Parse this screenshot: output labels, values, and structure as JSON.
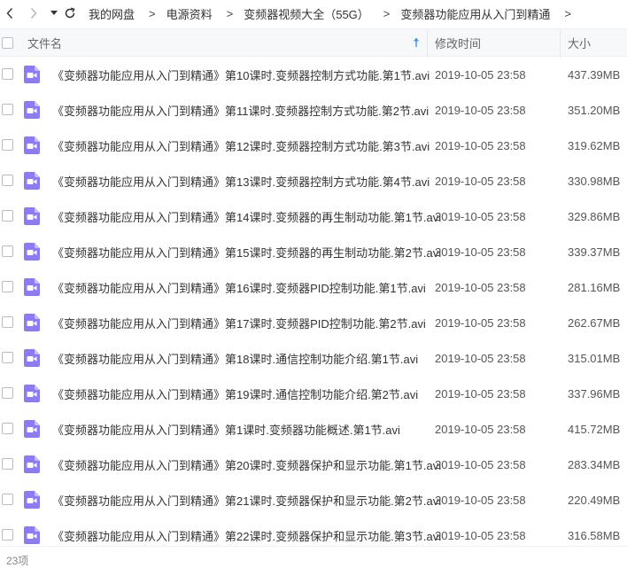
{
  "nav": {
    "breadcrumb": [
      "我的网盘",
      "电源资料",
      "变频器视频大全（55G）",
      "变频器功能应用从入门到精通"
    ],
    "separator": ">"
  },
  "header": {
    "name_label": "文件名",
    "time_label": "修改时间",
    "size_label": "大小"
  },
  "files": [
    {
      "name": "《变频器功能应用从入门到精通》第10课时.变频器控制方式功能.第1节.avi",
      "time": "2019-10-05 23:58",
      "size": "437.39MB"
    },
    {
      "name": "《变频器功能应用从入门到精通》第11课时.变频器控制方式功能.第2节.avi",
      "time": "2019-10-05 23:58",
      "size": "351.20MB"
    },
    {
      "name": "《变频器功能应用从入门到精通》第12课时.变频器控制方式功能.第3节.avi",
      "time": "2019-10-05 23:58",
      "size": "319.62MB"
    },
    {
      "name": "《变频器功能应用从入门到精通》第13课时.变频器控制方式功能.第4节.avi",
      "time": "2019-10-05 23:58",
      "size": "330.98MB"
    },
    {
      "name": "《变频器功能应用从入门到精通》第14课时.变频器的再生制动功能.第1节.avi",
      "time": "2019-10-05 23:58",
      "size": "329.86MB"
    },
    {
      "name": "《变频器功能应用从入门到精通》第15课时.变频器的再生制动功能.第2节.avi",
      "time": "2019-10-05 23:58",
      "size": "339.37MB"
    },
    {
      "name": "《变频器功能应用从入门到精通》第16课时.变频器PID控制功能.第1节.avi",
      "time": "2019-10-05 23:58",
      "size": "281.16MB"
    },
    {
      "name": "《变频器功能应用从入门到精通》第17课时.变频器PID控制功能.第2节.avi",
      "time": "2019-10-05 23:58",
      "size": "262.67MB"
    },
    {
      "name": "《变频器功能应用从入门到精通》第18课时.通信控制功能介绍.第1节.avi",
      "time": "2019-10-05 23:58",
      "size": "315.01MB"
    },
    {
      "name": "《变频器功能应用从入门到精通》第19课时.通信控制功能介绍.第2节.avi",
      "time": "2019-10-05 23:58",
      "size": "337.96MB"
    },
    {
      "name": "《变频器功能应用从入门到精通》第1课时.变频器功能概述.第1节.avi",
      "time": "2019-10-05 23:58",
      "size": "415.72MB"
    },
    {
      "name": "《变频器功能应用从入门到精通》第20课时.变频器保护和显示功能.第1节.avi",
      "time": "2019-10-05 23:58",
      "size": "283.34MB"
    },
    {
      "name": "《变频器功能应用从入门到精通》第21课时.变频器保护和显示功能.第2节.avi",
      "time": "2019-10-05 23:58",
      "size": "220.49MB"
    },
    {
      "name": "《变频器功能应用从入门到精通》第22课时.变频器保护和显示功能.第3节.avi",
      "time": "2019-10-05 23:58",
      "size": "316.58MB"
    }
  ],
  "footer": {
    "count": "23项"
  },
  "colors": {
    "video_icon": "#8b7cf6",
    "sort_arrow": "#3b8ef5",
    "header_bg": "#f7f8fa"
  },
  "icons": {
    "back": "chevron-left-icon",
    "forward": "chevron-right-icon",
    "history": "caret-down-icon",
    "refresh": "refresh-icon",
    "sort": "sort-up-arrow-icon",
    "file": "video-file-icon"
  }
}
